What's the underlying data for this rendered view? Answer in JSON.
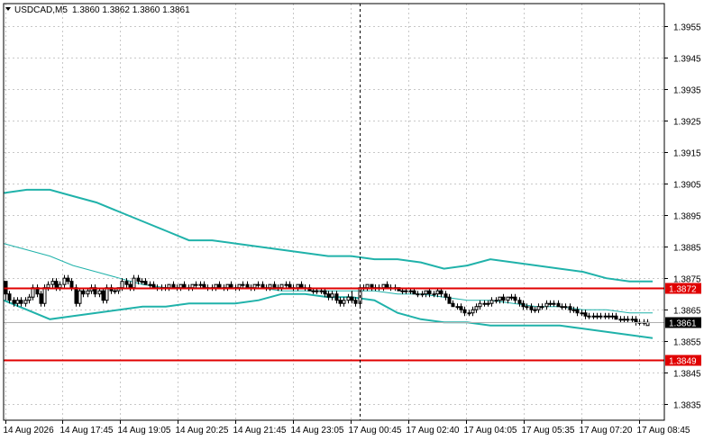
{
  "header": {
    "symbol_label": "USDCAD,M5",
    "ohlc_label": "1.3860 1.3862 1.3860 1.3861"
  },
  "colors": {
    "background": "#ffffff",
    "grid": "#c8c8c8",
    "axis": "#000000",
    "candle": "#000000",
    "bollinger": "#20b2aa",
    "level_line": "#e00000",
    "level_label_bg": "#e00000",
    "level_label_text": "#ffffff",
    "price_label_bg": "#000000",
    "price_label_text": "#ffffff",
    "crosshair": "#000000"
  },
  "chart_data": {
    "type": "candlestick",
    "symbol": "USDCAD",
    "timeframe": "M5",
    "ylim": [
      1.383,
      1.3962
    ],
    "y_ticks": [
      "1.3955",
      "1.3945",
      "1.3935",
      "1.3925",
      "1.3915",
      "1.3905",
      "1.3895",
      "1.3885",
      "1.3875",
      "1.3865",
      "1.3855",
      "1.3845",
      "1.3835"
    ],
    "x_ticks": [
      "14 Aug 2026",
      "14 Aug 17:45",
      "14 Aug 19:05",
      "14 Aug 20:25",
      "14 Aug 21:45",
      "14 Aug 23:05",
      "17 Aug 00:45",
      "17 Aug 02:40",
      "17 Aug 04:05",
      "17 Aug 05:35",
      "17 Aug 07:20",
      "17 Aug 08:45"
    ],
    "current_price": "1.3861",
    "horizontal_levels": [
      {
        "price": 1.3872,
        "label": "1.3872"
      },
      {
        "price": 1.3849,
        "label": "1.3849"
      }
    ],
    "crosshair_candle_index": 91,
    "bollinger_upper": [
      1.3902,
      1.3903,
      1.3903,
      1.3901,
      1.3899,
      1.3896,
      1.3893,
      1.389,
      1.3887,
      1.3887,
      1.3886,
      1.3885,
      1.3884,
      1.3883,
      1.3882,
      1.3882,
      1.3881,
      1.3881,
      1.388,
      1.3878,
      1.3879,
      1.3881,
      1.388,
      1.3879,
      1.3878,
      1.3877,
      1.3875,
      1.3874,
      1.3874
    ],
    "bollinger_middle": [
      1.3886,
      1.3884,
      1.3882,
      1.3879,
      1.3877,
      1.3875,
      1.3873,
      1.3872,
      1.3872,
      1.3872,
      1.3872,
      1.3872,
      1.3871,
      1.3871,
      1.3871,
      1.3871,
      1.3871,
      1.387,
      1.387,
      1.3869,
      1.3868,
      1.3868,
      1.3867,
      1.3866,
      1.3866,
      1.3865,
      1.3865,
      1.3864,
      1.3864
    ],
    "bollinger_lower": [
      1.3868,
      1.3865,
      1.3862,
      1.3863,
      1.3864,
      1.3865,
      1.3866,
      1.3866,
      1.3867,
      1.3867,
      1.3867,
      1.3868,
      1.387,
      1.387,
      1.3869,
      1.3869,
      1.3868,
      1.3864,
      1.3862,
      1.3861,
      1.3861,
      1.386,
      1.386,
      1.386,
      1.386,
      1.3859,
      1.3858,
      1.3857,
      1.3856
    ],
    "candles": [
      [
        1.3874,
        1.3874,
        1.3868,
        1.387
      ],
      [
        1.387,
        1.3871,
        1.3867,
        1.3868
      ],
      [
        1.3868,
        1.3869,
        1.3866,
        1.3867
      ],
      [
        1.3867,
        1.3869,
        1.3866,
        1.3868
      ],
      [
        1.3868,
        1.3869,
        1.3866,
        1.3867
      ],
      [
        1.3867,
        1.3869,
        1.3866,
        1.3868
      ],
      [
        1.3868,
        1.387,
        1.3867,
        1.3869
      ],
      [
        1.3869,
        1.3873,
        1.3868,
        1.3872
      ],
      [
        1.3872,
        1.3873,
        1.3869,
        1.387
      ],
      [
        1.387,
        1.3871,
        1.3866,
        1.3867
      ],
      [
        1.3867,
        1.3873,
        1.3866,
        1.3872
      ],
      [
        1.3872,
        1.3874,
        1.3871,
        1.3873
      ],
      [
        1.3873,
        1.3875,
        1.3872,
        1.3874
      ],
      [
        1.3874,
        1.3875,
        1.3871,
        1.3872
      ],
      [
        1.3872,
        1.3874,
        1.3871,
        1.3873
      ],
      [
        1.3873,
        1.3876,
        1.3872,
        1.3875
      ],
      [
        1.3875,
        1.3876,
        1.3873,
        1.3874
      ],
      [
        1.3874,
        1.3875,
        1.3871,
        1.3872
      ],
      [
        1.3872,
        1.3873,
        1.3866,
        1.3867
      ],
      [
        1.3867,
        1.3872,
        1.3866,
        1.3871
      ],
      [
        1.3871,
        1.3872,
        1.3869,
        1.387
      ],
      [
        1.387,
        1.3872,
        1.3869,
        1.3871
      ],
      [
        1.3871,
        1.3873,
        1.387,
        1.3872
      ],
      [
        1.3872,
        1.3873,
        1.3869,
        1.387
      ],
      [
        1.387,
        1.3872,
        1.3869,
        1.3871
      ],
      [
        1.3871,
        1.3872,
        1.3867,
        1.3868
      ],
      [
        1.3868,
        1.3873,
        1.3867,
        1.3872
      ],
      [
        1.3872,
        1.3873,
        1.387,
        1.3871
      ],
      [
        1.3871,
        1.3872,
        1.387,
        1.3871
      ],
      [
        1.3871,
        1.3872,
        1.387,
        1.3872
      ],
      [
        1.3872,
        1.3875,
        1.3871,
        1.3874
      ],
      [
        1.3874,
        1.3875,
        1.3872,
        1.3873
      ],
      [
        1.3873,
        1.3874,
        1.3871,
        1.3872
      ],
      [
        1.3872,
        1.3876,
        1.3871,
        1.3875
      ],
      [
        1.3875,
        1.3876,
        1.3873,
        1.3874
      ],
      [
        1.3874,
        1.3875,
        1.3873,
        1.3874
      ],
      [
        1.3874,
        1.3875,
        1.3873,
        1.3873
      ],
      [
        1.3873,
        1.3874,
        1.3872,
        1.3873
      ],
      [
        1.3873,
        1.3874,
        1.3872,
        1.3872
      ],
      [
        1.3872,
        1.3873,
        1.3871,
        1.3872
      ],
      [
        1.3872,
        1.3873,
        1.3871,
        1.3872
      ],
      [
        1.3872,
        1.3873,
        1.3871,
        1.3872
      ],
      [
        1.3872,
        1.3873,
        1.3871,
        1.3873
      ],
      [
        1.3873,
        1.3874,
        1.3872,
        1.3872
      ],
      [
        1.3872,
        1.3873,
        1.3871,
        1.3872
      ],
      [
        1.3872,
        1.3873,
        1.3871,
        1.3873
      ],
      [
        1.3873,
        1.3874,
        1.3872,
        1.3872
      ],
      [
        1.3872,
        1.3873,
        1.3871,
        1.3872
      ],
      [
        1.3872,
        1.3873,
        1.3871,
        1.3873
      ],
      [
        1.3873,
        1.3874,
        1.3872,
        1.3873
      ],
      [
        1.3873,
        1.3874,
        1.3872,
        1.3873
      ],
      [
        1.3873,
        1.3874,
        1.3872,
        1.3872
      ],
      [
        1.3872,
        1.3873,
        1.3871,
        1.3872
      ],
      [
        1.3872,
        1.3873,
        1.3871,
        1.3872
      ],
      [
        1.3872,
        1.3873,
        1.3871,
        1.3873
      ],
      [
        1.3873,
        1.3874,
        1.3872,
        1.3872
      ],
      [
        1.3872,
        1.3873,
        1.3871,
        1.3872
      ],
      [
        1.3872,
        1.3873,
        1.3871,
        1.3873
      ],
      [
        1.3873,
        1.3874,
        1.3872,
        1.3872
      ],
      [
        1.3872,
        1.3873,
        1.3871,
        1.3872
      ],
      [
        1.3872,
        1.3873,
        1.3871,
        1.3873
      ],
      [
        1.3873,
        1.3874,
        1.3872,
        1.3873
      ],
      [
        1.3873,
        1.3874,
        1.3872,
        1.3872
      ],
      [
        1.3872,
        1.3873,
        1.3871,
        1.3872
      ],
      [
        1.3872,
        1.3873,
        1.3871,
        1.3873
      ],
      [
        1.3873,
        1.3874,
        1.3872,
        1.3873
      ],
      [
        1.3873,
        1.3874,
        1.3872,
        1.3872
      ],
      [
        1.3872,
        1.3873,
        1.3871,
        1.3872
      ],
      [
        1.3872,
        1.3873,
        1.3871,
        1.3873
      ],
      [
        1.3873,
        1.3874,
        1.3872,
        1.3872
      ],
      [
        1.3872,
        1.3873,
        1.3871,
        1.3872
      ],
      [
        1.3872,
        1.3873,
        1.3871,
        1.3873
      ],
      [
        1.3873,
        1.3874,
        1.3872,
        1.3873
      ],
      [
        1.3873,
        1.3874,
        1.3872,
        1.3872
      ],
      [
        1.3872,
        1.3873,
        1.3871,
        1.3872
      ],
      [
        1.3872,
        1.3873,
        1.3871,
        1.3873
      ],
      [
        1.3873,
        1.3874,
        1.3872,
        1.3872
      ],
      [
        1.3872,
        1.3873,
        1.3871,
        1.3872
      ],
      [
        1.3872,
        1.3873,
        1.3871,
        1.3871
      ],
      [
        1.3871,
        1.3872,
        1.387,
        1.3871
      ],
      [
        1.3871,
        1.3872,
        1.387,
        1.3871
      ],
      [
        1.3871,
        1.3872,
        1.387,
        1.3871
      ],
      [
        1.3871,
        1.3872,
        1.3869,
        1.387
      ],
      [
        1.387,
        1.3871,
        1.3868,
        1.3869
      ],
      [
        1.3869,
        1.3871,
        1.3868,
        1.387
      ],
      [
        1.387,
        1.3871,
        1.3867,
        1.3868
      ],
      [
        1.3868,
        1.3869,
        1.3866,
        1.3867
      ],
      [
        1.3867,
        1.3869,
        1.3866,
        1.3868
      ],
      [
        1.3868,
        1.387,
        1.3867,
        1.3869
      ],
      [
        1.3869,
        1.3871,
        1.3867,
        1.3868
      ],
      [
        1.3868,
        1.3869,
        1.3866,
        1.3867
      ],
      [
        1.3867,
        1.3873,
        1.3866,
        1.3872
      ],
      [
        1.3872,
        1.3873,
        1.3871,
        1.3872
      ],
      [
        1.3872,
        1.3873,
        1.3871,
        1.3873
      ],
      [
        1.3873,
        1.3873,
        1.3871,
        1.3872
      ],
      [
        1.3872,
        1.3873,
        1.3871,
        1.3872
      ],
      [
        1.3872,
        1.3873,
        1.3871,
        1.3872
      ],
      [
        1.3872,
        1.3873,
        1.3871,
        1.3873
      ],
      [
        1.3873,
        1.3874,
        1.3872,
        1.3872
      ],
      [
        1.3872,
        1.3873,
        1.3871,
        1.3872
      ],
      [
        1.3872,
        1.3873,
        1.3871,
        1.3872
      ],
      [
        1.3872,
        1.3872,
        1.3871,
        1.3871
      ],
      [
        1.3871,
        1.3872,
        1.387,
        1.3871
      ],
      [
        1.3871,
        1.3872,
        1.387,
        1.3871
      ],
      [
        1.3871,
        1.3872,
        1.387,
        1.3871
      ],
      [
        1.3871,
        1.3872,
        1.387,
        1.387
      ],
      [
        1.387,
        1.3871,
        1.3869,
        1.387
      ],
      [
        1.387,
        1.3871,
        1.3869,
        1.387
      ],
      [
        1.387,
        1.3871,
        1.3869,
        1.3871
      ],
      [
        1.3871,
        1.3872,
        1.3869,
        1.387
      ],
      [
        1.387,
        1.3871,
        1.3869,
        1.387
      ],
      [
        1.387,
        1.3872,
        1.3869,
        1.3871
      ],
      [
        1.3871,
        1.3872,
        1.3869,
        1.387
      ],
      [
        1.387,
        1.3871,
        1.3868,
        1.3869
      ],
      [
        1.3869,
        1.387,
        1.3867,
        1.3867
      ],
      [
        1.3867,
        1.3868,
        1.3866,
        1.3866
      ],
      [
        1.3866,
        1.3867,
        1.3865,
        1.3866
      ],
      [
        1.3866,
        1.3867,
        1.3864,
        1.3865
      ],
      [
        1.3865,
        1.3866,
        1.3863,
        1.3864
      ],
      [
        1.3864,
        1.3865,
        1.3863,
        1.3864
      ],
      [
        1.3864,
        1.3866,
        1.3863,
        1.3865
      ],
      [
        1.3865,
        1.3867,
        1.3864,
        1.3866
      ],
      [
        1.3866,
        1.3868,
        1.3865,
        1.3867
      ],
      [
        1.3867,
        1.3868,
        1.3866,
        1.3867
      ],
      [
        1.3867,
        1.3868,
        1.3866,
        1.3867
      ],
      [
        1.3867,
        1.3869,
        1.3866,
        1.3868
      ],
      [
        1.3868,
        1.3869,
        1.3867,
        1.3868
      ],
      [
        1.3868,
        1.3869,
        1.3867,
        1.3869
      ],
      [
        1.3869,
        1.387,
        1.3867,
        1.3868
      ],
      [
        1.3868,
        1.3869,
        1.3867,
        1.3869
      ],
      [
        1.3869,
        1.387,
        1.3868,
        1.3869
      ],
      [
        1.3869,
        1.387,
        1.3867,
        1.3868
      ],
      [
        1.3868,
        1.3869,
        1.3866,
        1.3867
      ],
      [
        1.3867,
        1.3868,
        1.3865,
        1.3866
      ],
      [
        1.3866,
        1.3867,
        1.3865,
        1.3866
      ],
      [
        1.3866,
        1.3867,
        1.3864,
        1.3865
      ],
      [
        1.3865,
        1.3866,
        1.3864,
        1.3865
      ],
      [
        1.3865,
        1.3867,
        1.3864,
        1.3866
      ],
      [
        1.3866,
        1.3867,
        1.3865,
        1.3866
      ],
      [
        1.3866,
        1.3868,
        1.3865,
        1.3867
      ],
      [
        1.3867,
        1.3868,
        1.3866,
        1.3867
      ],
      [
        1.3867,
        1.3868,
        1.3866,
        1.3867
      ],
      [
        1.3867,
        1.3868,
        1.3866,
        1.3866
      ],
      [
        1.3866,
        1.3867,
        1.3865,
        1.3866
      ],
      [
        1.3866,
        1.3867,
        1.3865,
        1.3866
      ],
      [
        1.3866,
        1.3867,
        1.3864,
        1.3865
      ],
      [
        1.3865,
        1.3866,
        1.3864,
        1.3865
      ],
      [
        1.3865,
        1.3866,
        1.3863,
        1.3864
      ],
      [
        1.3864,
        1.3865,
        1.3863,
        1.3864
      ],
      [
        1.3864,
        1.3865,
        1.3862,
        1.3863
      ],
      [
        1.3863,
        1.3864,
        1.3862,
        1.3863
      ],
      [
        1.3863,
        1.3864,
        1.3862,
        1.3863
      ],
      [
        1.3863,
        1.3864,
        1.3862,
        1.3863
      ],
      [
        1.3863,
        1.3864,
        1.3862,
        1.3863
      ],
      [
        1.3863,
        1.3864,
        1.3862,
        1.3863
      ],
      [
        1.3863,
        1.3864,
        1.3862,
        1.3863
      ],
      [
        1.3863,
        1.3864,
        1.3862,
        1.3863
      ],
      [
        1.3863,
        1.3864,
        1.3862,
        1.3862
      ],
      [
        1.3862,
        1.3863,
        1.3861,
        1.3862
      ],
      [
        1.3862,
        1.3863,
        1.3861,
        1.3862
      ],
      [
        1.3862,
        1.3863,
        1.3861,
        1.3862
      ],
      [
        1.3862,
        1.3863,
        1.3861,
        1.3862
      ],
      [
        1.3862,
        1.3863,
        1.386,
        1.3861
      ],
      [
        1.3861,
        1.3862,
        1.386,
        1.3861
      ],
      [
        1.3861,
        1.3862,
        1.386,
        1.3861
      ],
      [
        1.386,
        1.3862,
        1.386,
        1.3861
      ]
    ]
  }
}
